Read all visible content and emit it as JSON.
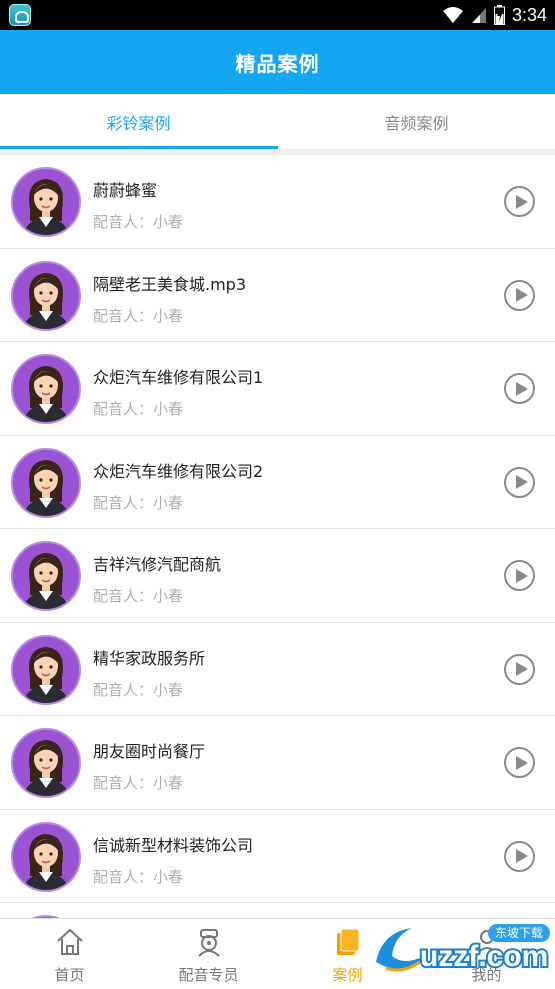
{
  "status_bar": {
    "time": "3:34"
  },
  "app_bar": {
    "title": "精品案例"
  },
  "tabs": [
    {
      "label": "彩铃案例",
      "active": true
    },
    {
      "label": "音频案例",
      "active": false
    }
  ],
  "list": [
    {
      "title": "蔚蔚蜂蜜",
      "subtitle": "配音人：小春"
    },
    {
      "title": "隔壁老王美食城.mp3",
      "subtitle": "配音人：小春"
    },
    {
      "title": "众炬汽车维修有限公司1",
      "subtitle": "配音人：小春"
    },
    {
      "title": "众炬汽车维修有限公司2",
      "subtitle": "配音人：小春"
    },
    {
      "title": "吉祥汽修汽配商航",
      "subtitle": "配音人：小春"
    },
    {
      "title": "精华家政服务所",
      "subtitle": "配音人：小春"
    },
    {
      "title": "朋友圈时尚餐厅",
      "subtitle": "配音人：小春"
    },
    {
      "title": "信诚新型材料装饰公司",
      "subtitle": "配音人：小春"
    },
    {
      "title": "",
      "subtitle": ""
    }
  ],
  "bottom_nav": [
    {
      "label": "首页",
      "icon": "home-icon",
      "active": false
    },
    {
      "label": "配音专员",
      "icon": "voice-actor-icon",
      "active": false
    },
    {
      "label": "案例",
      "icon": "cases-icon",
      "active": true
    },
    {
      "label": "我的",
      "icon": "profile-icon",
      "active": false
    }
  ],
  "watermark": {
    "text": "uzzf.com",
    "sub_text": "东坡下载"
  },
  "colors": {
    "primary": "#14a7f1",
    "accent": "#f4a100",
    "avatar_bg": "#9b53d3"
  }
}
